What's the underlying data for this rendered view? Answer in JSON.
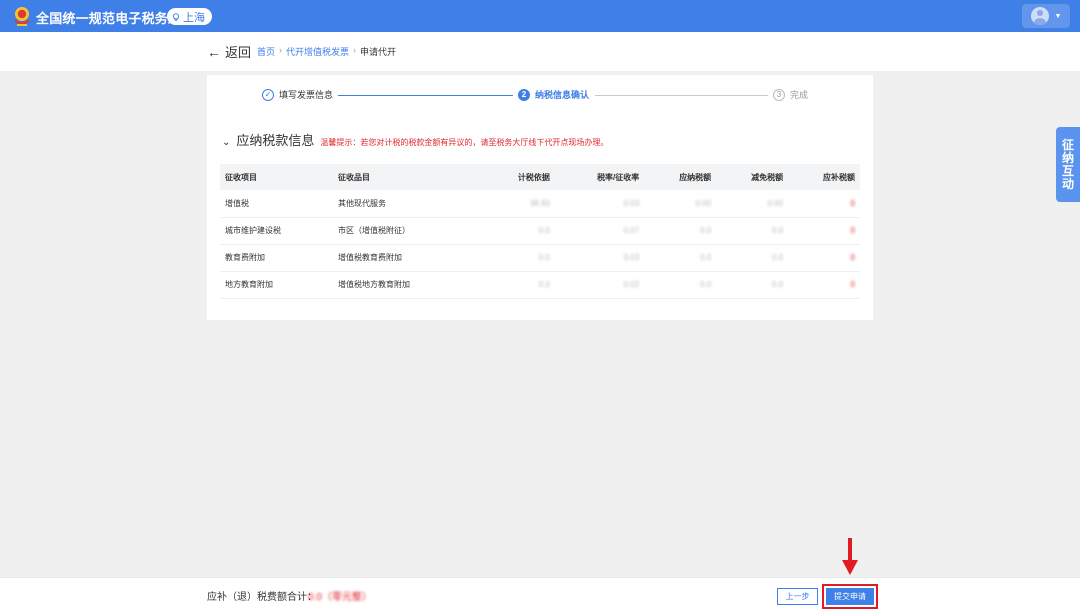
{
  "header": {
    "app_title": "全国统一规范电子税务局",
    "region": "上海",
    "emblem_icon": "tax-emblem-icon",
    "colors": {
      "primary": "#3f7fe8",
      "alert": "#e0262b",
      "highlight_frame": "#e11b22"
    }
  },
  "subbar": {
    "back_label": "返回",
    "breadcrumb": {
      "home": "首页",
      "separator": "›",
      "section": "代开增值税发票",
      "current": "申请代开"
    }
  },
  "steps": [
    {
      "label": "填写发票信息",
      "marker": "✓",
      "state": "done"
    },
    {
      "label": "纳税信息确认",
      "marker": "2",
      "state": "active"
    },
    {
      "label": "完成",
      "marker": "3",
      "state": "wait"
    }
  ],
  "section": {
    "title": "应纳税款信息",
    "notice": "温馨提示：若您对计税的税款金额有异议的，请至税务大厅线下代开点现场办理。"
  },
  "table": {
    "headers": [
      "征收项目",
      "征收品目",
      "计税依据",
      "税率/征收率",
      "应纳税额",
      "减免税额",
      "应补税额"
    ],
    "rows": [
      {
        "item": "增值税",
        "category": "其他现代服务",
        "basis": "38.83",
        "rate": "0.03",
        "payable": "0.00",
        "reduction": "0.00",
        "due": "0"
      },
      {
        "item": "城市维护建设税",
        "category": "市区（增值税附征）",
        "basis": "0.0",
        "rate": "0.07",
        "payable": "0.0",
        "reduction": "0.0",
        "due": "0"
      },
      {
        "item": "教育费附加",
        "category": "增值税教育费附加",
        "basis": "0.0",
        "rate": "0.03",
        "payable": "0.0",
        "reduction": "0.0",
        "due": "0"
      },
      {
        "item": "地方教育附加",
        "category": "增值税地方教育附加",
        "basis": "0.0",
        "rate": "0.02",
        "payable": "0.0",
        "reduction": "0.0",
        "due": "0"
      }
    ]
  },
  "side_tab": {
    "chars": [
      "征",
      "纳",
      "互",
      "动"
    ]
  },
  "footer": {
    "total_label": "应补（退）税费额合计：",
    "total_value": "0.0（零元整）",
    "prev_label": "上一步",
    "submit_label": "提交申请"
  }
}
